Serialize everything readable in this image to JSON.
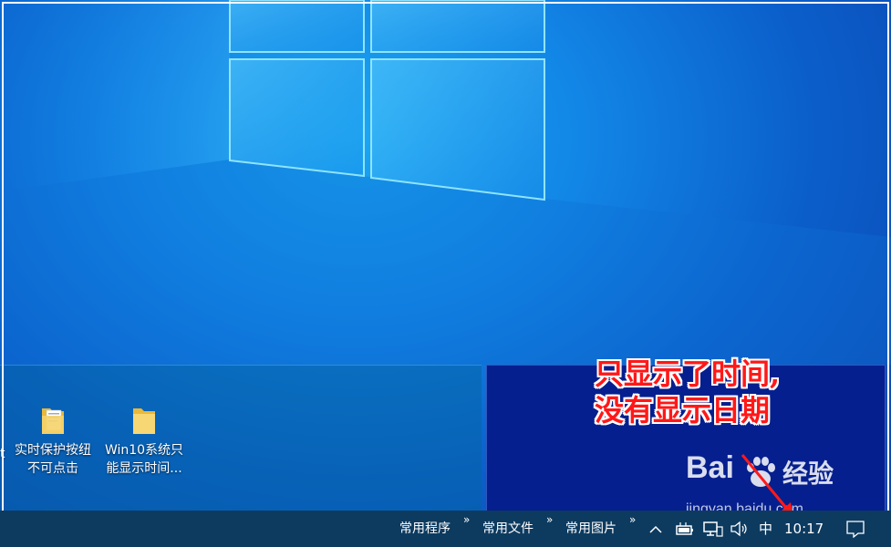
{
  "desktop": {
    "icons": [
      {
        "label_line1": "实时保护按纽",
        "label_line2": "不可点击"
      },
      {
        "label_line1": "Win10系统只",
        "label_line2": "能显示时间..."
      }
    ],
    "cut_label": "t"
  },
  "annotation": {
    "line1": "只显示了时间,",
    "line2": "没有显示日期"
  },
  "taskbar": {
    "toolbars": [
      "常用程序",
      "常用文件",
      "常用图片"
    ],
    "ime": "中",
    "clock": "10:17"
  },
  "watermark": {
    "brand": "Bai",
    "brand_suffix": "经验",
    "url": "jingyan.baidu.com"
  },
  "colors": {
    "annotation": "#ff1818",
    "taskbar": "#0d3b60",
    "panel_right": "#061f8e"
  }
}
